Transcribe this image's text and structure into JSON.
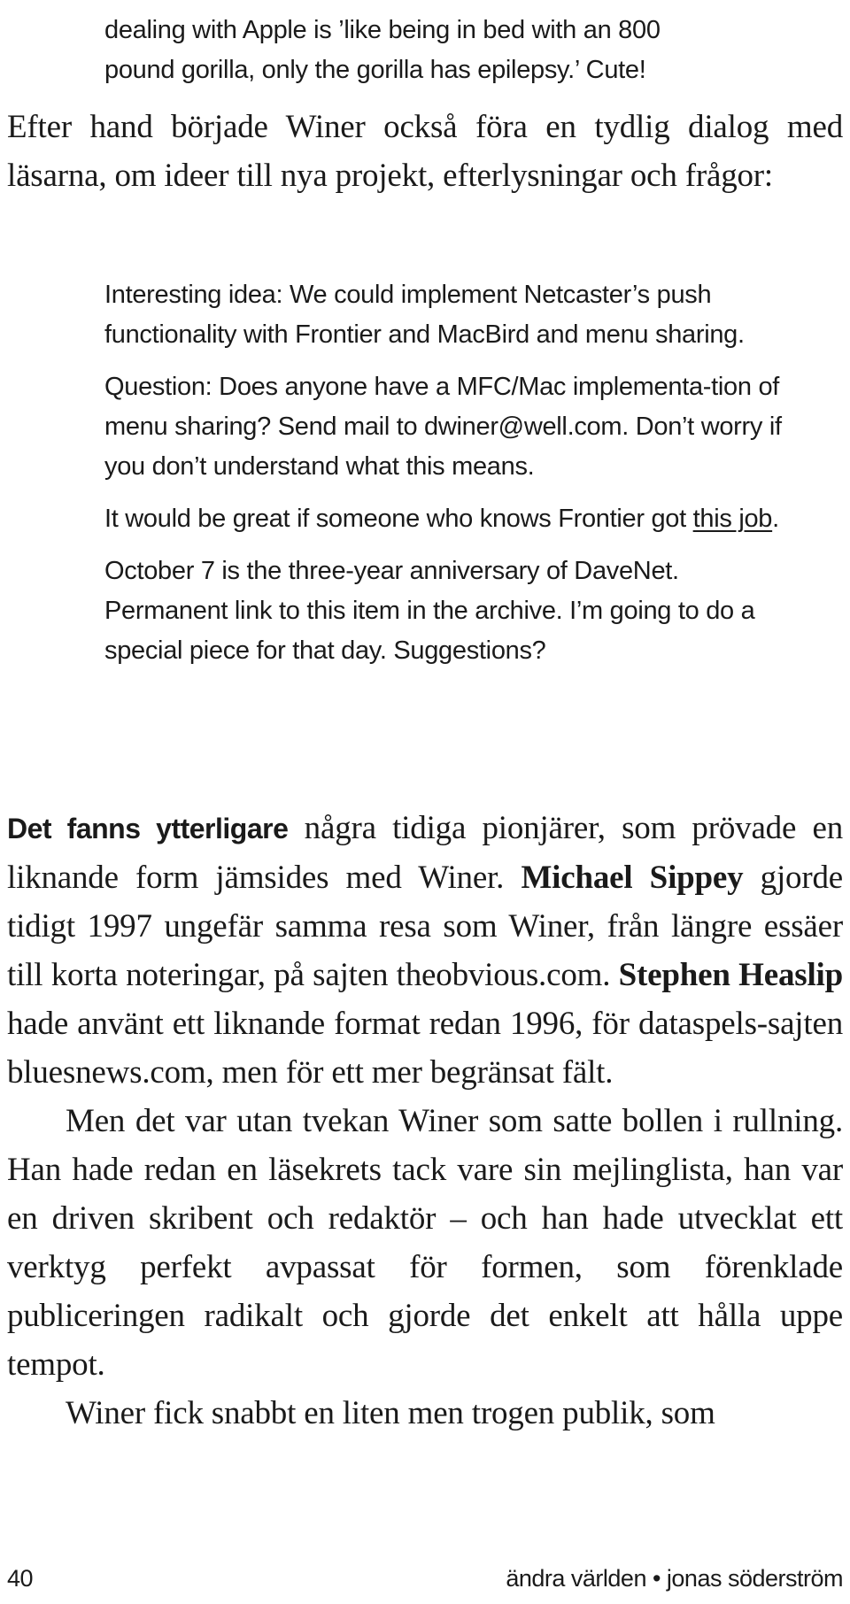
{
  "top_quote": {
    "line1": "dealing with Apple is ’like being in bed with an 800",
    "line2": "pound gorilla, only the gorilla has epilepsy.’ Cute!"
  },
  "intro_paragraph": "Efter hand började Winer också föra en tydlig dialog med läsarna, om ideer till nya projekt, efterlysningar och frågor:",
  "quotes": [
    {
      "text": "Interesting idea: We could implement Netcaster’s push functionality with Frontier and MacBird and menu sharing."
    },
    {
      "text": "Question: Does anyone have a MFC/Mac implementa-tion of menu sharing? Send mail to dwiner@well.com. Don’t worry if you don’t understand what this means."
    },
    {
      "text_before": "It would be great if someone who knows Frontier got ",
      "link": "this job",
      "text_after": "."
    },
    {
      "text": "October 7 is the three-year anniversary of DaveNet. Permanent link to this item in the archive. I’m going to do a special piece for that day. Suggestions?"
    }
  ],
  "section_paragraph": {
    "lead_bold": "Det fanns ytterligare",
    "part1": " några tidiga pionjärer, som prövade en liknande form jämsides med Winer. ",
    "name1": "Michael Sippey",
    "part2": " gjorde tidigt 1997 ungefär samma resa som Winer, från längre essäer till korta noteringar, på sajten theobvious.com. ",
    "name2": "Stephen Heaslip",
    "part3": " hade använt ett liknande format redan 1996, för dataspels-sajten bluesnews.com, men för ett mer begränsat fält."
  },
  "paragraph2": "Men det var utan tvekan Winer som satte bollen i rullning. Han hade redan en läsekrets tack vare sin mejlinglista, han var en driven skribent och redaktör – och han hade utvecklat ett verktyg perfekt avpassat för formen, som förenklade publiceringen radikalt och gjorde det enkelt att hålla uppe tempot.",
  "paragraph3": "Winer fick snabbt en liten men trogen publik, som",
  "footer": {
    "page_number": "40",
    "running_title": "ändra världen • jonas söderström"
  }
}
